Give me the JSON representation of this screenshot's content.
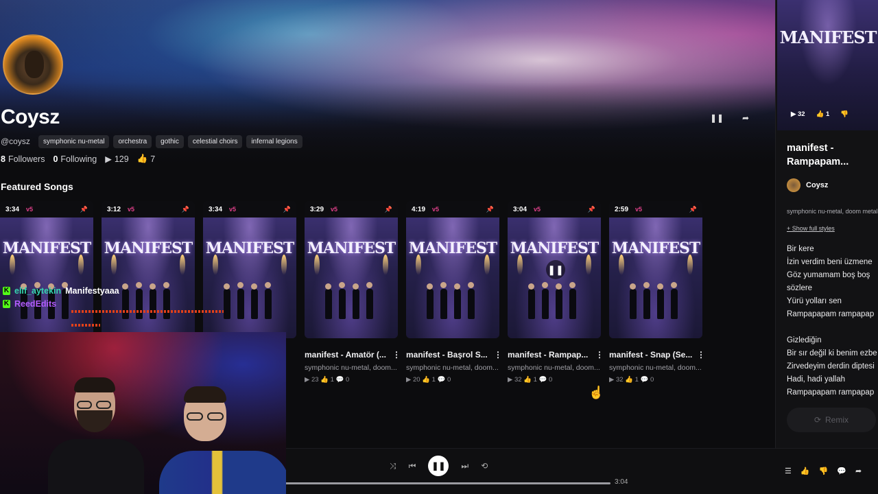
{
  "profile": {
    "name": "Coysz",
    "handle": "@coysz",
    "tags": [
      "symphonic nu-metal",
      "orchestra",
      "gothic",
      "celestial choirs",
      "infernal legions"
    ],
    "followers_count": "8",
    "followers_label": "Followers",
    "following_count": "0",
    "following_label": "Following",
    "plays": "129",
    "likes": "7"
  },
  "featured": {
    "title": "Featured Songs",
    "songs": [
      {
        "duration": "3:34",
        "version": "v5",
        "title": "",
        "style": "",
        "stats": ""
      },
      {
        "duration": "3:12",
        "version": "v5",
        "title": "",
        "style": "",
        "stats": ""
      },
      {
        "duration": "3:34",
        "version": "v5",
        "title": "",
        "style": "",
        "stats": ""
      },
      {
        "duration": "3:29",
        "version": "v5",
        "title": "manifest - Amatör (...",
        "style": "symphonic nu-metal, doom...",
        "stats": "▶ 23  👍 1  💬 0"
      },
      {
        "duration": "4:19",
        "version": "v5",
        "title": "manifest - Başrol S...",
        "style": "symphonic nu-metal, doom...",
        "stats": "▶ 20  👍 1  💬 0"
      },
      {
        "duration": "3:04",
        "version": "v5",
        "title": "manifest - Rampap...",
        "style": "symphonic nu-metal, doom...",
        "stats": "▶ 32  👍 1  💬 0"
      },
      {
        "duration": "2:59",
        "version": "v5",
        "title": "manifest - Snap (Se...",
        "style": "symphonic nu-metal, doom...",
        "stats": "▶ 32  👍 1  💬 0"
      }
    ],
    "art_text": "MANIFEST"
  },
  "now_playing": {
    "art_text": "MANIFEST",
    "art_plays": "32",
    "art_likes": "1",
    "title": "manifest - Rampapam...",
    "artist": "Coysz",
    "styles": "symphonic nu-metal, doom metal",
    "show_styles": "+ Show full styles",
    "lyrics": [
      "Bir kere",
      "İzin verdim beni üzmene",
      "Göz yumamam boş boş",
      "sözlere",
      "Yürü yolları sen",
      "Rampapapam rampapap",
      "",
      "Gizlediğin",
      "Bir sır değil ki benim ezbe",
      "Zirvedeyim derdin diptesi",
      "Hadi, hadi yallah",
      "Rampapapam rampapap"
    ],
    "remix_label": "Remix"
  },
  "player": {
    "elapsed": "3:04",
    "progress": 1.0
  },
  "chat": {
    "messages": [
      {
        "user": "elif_aytekin",
        "text": "Manifestyaaa"
      },
      {
        "user": "ReedEdits",
        "text": ""
      }
    ]
  },
  "colors": {
    "accent_version": "#e0408a",
    "kick_green": "#53fc18"
  }
}
